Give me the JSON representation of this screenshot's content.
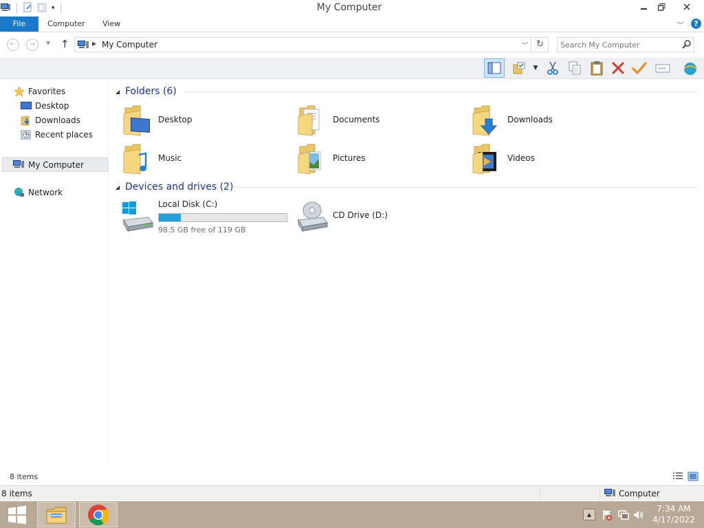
{
  "window": {
    "title": "My Computer"
  },
  "ribbon": {
    "tabs": [
      {
        "label": "File"
      },
      {
        "label": "Computer"
      },
      {
        "label": "View"
      }
    ]
  },
  "address": {
    "location": "My Computer",
    "search_placeholder": "Search My Computer"
  },
  "toolbar": {
    "buttons": [
      "layout-pane-icon",
      "folder-options-icon",
      "cut-icon",
      "copy-icon",
      "paste-icon",
      "delete-icon",
      "checkmark-icon",
      "rename-icon",
      "world-icon"
    ]
  },
  "nav": {
    "favorites": {
      "label": "Favorites",
      "items": [
        {
          "label": "Desktop"
        },
        {
          "label": "Downloads"
        },
        {
          "label": "Recent places"
        }
      ]
    },
    "my_computer": "My Computer",
    "network": "Network"
  },
  "content": {
    "folders_header": "Folders (6)",
    "folders": [
      {
        "label": "Desktop",
        "overlay": "desktop"
      },
      {
        "label": "Documents",
        "overlay": "documents"
      },
      {
        "label": "Downloads",
        "overlay": "downloads"
      },
      {
        "label": "Music",
        "overlay": "music"
      },
      {
        "label": "Pictures",
        "overlay": "pictures"
      },
      {
        "label": "Videos",
        "overlay": "videos"
      }
    ],
    "drives_header": "Devices and drives (2)",
    "drives": [
      {
        "label": "Local Disk (C:)",
        "free_text": "98.5 GB free of 119 GB",
        "used_fraction": 0.17
      },
      {
        "label": "CD Drive (D:)"
      }
    ]
  },
  "status": {
    "item_count": "8 items",
    "details_count": "8 items",
    "details_location": "Computer"
  },
  "taskbar": {
    "clock_time": "7:34 AM",
    "clock_date": "4/17/2022"
  },
  "colors": {
    "accent": "#1979ca",
    "group_header": "#1e3287",
    "drive_fill": "#26a0da",
    "taskbar": "#b8a895"
  }
}
